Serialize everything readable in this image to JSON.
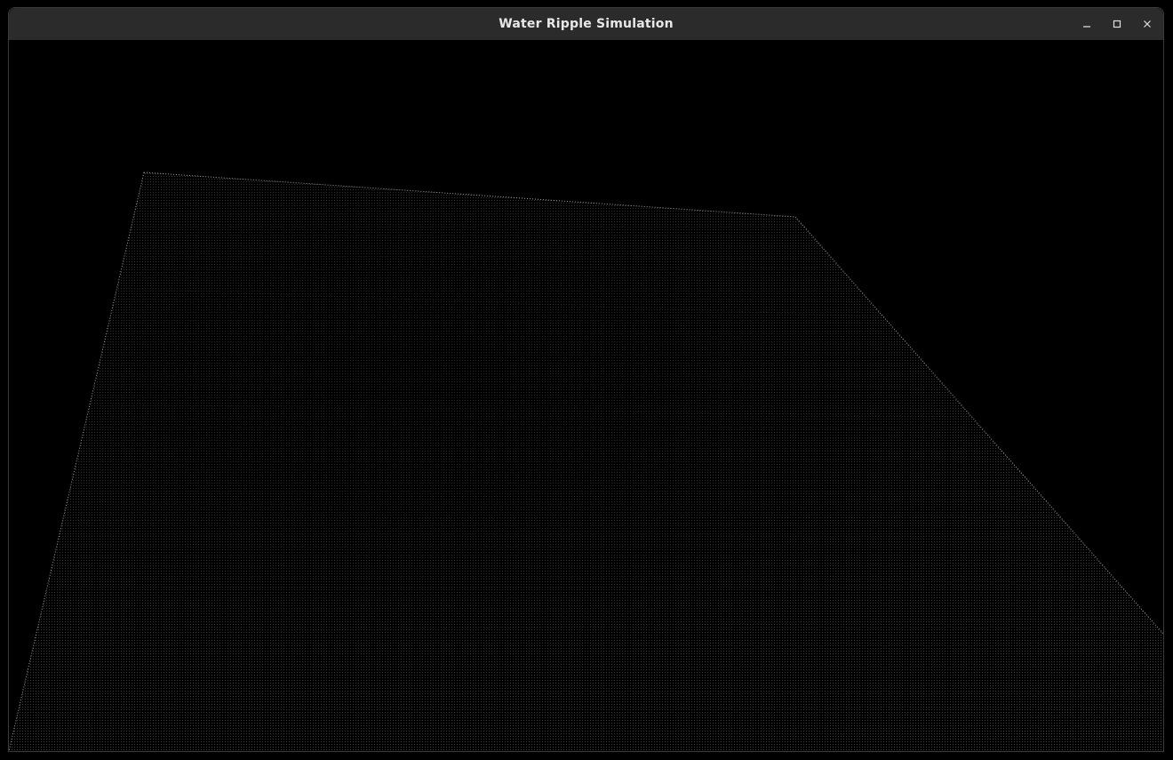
{
  "window": {
    "title": "Water Ripple Simulation",
    "controls": {
      "minimize_icon": "minimize-icon",
      "maximize_icon": "maximize-icon",
      "close_icon": "close-icon"
    }
  },
  "scene": {
    "background_color": "#000000",
    "mesh_color": "#d0d0d0",
    "mesh_style": "point-grid water surface in perspective"
  }
}
